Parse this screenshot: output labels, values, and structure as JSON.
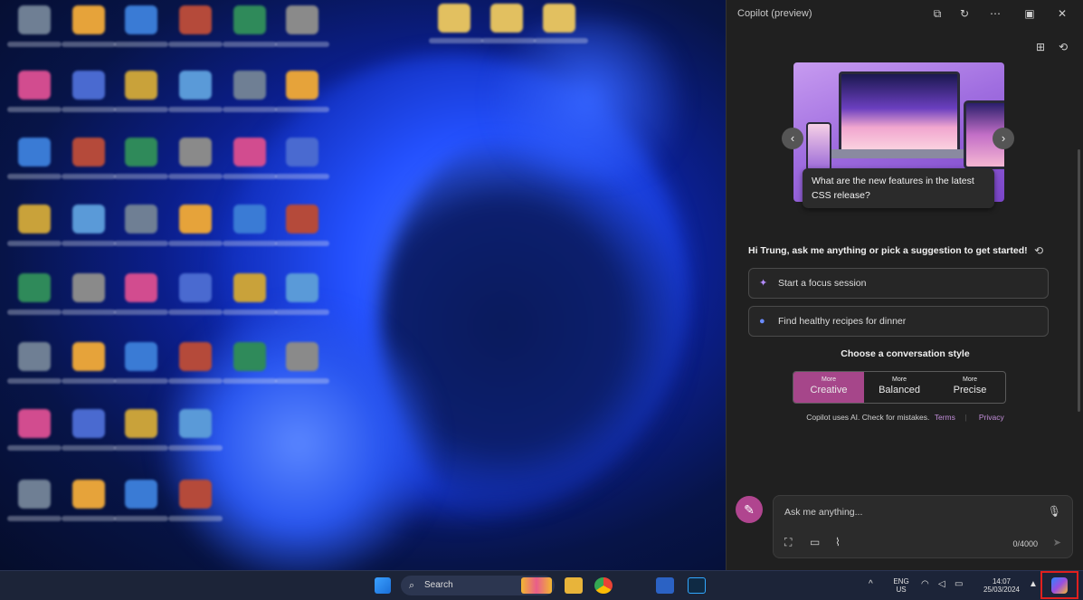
{
  "panel": {
    "title": "Copilot (preview)",
    "hero_caption": "What are the new features in the latest CSS release?",
    "greeting": "Hi Trung, ask me anything or pick a suggestion to get started!",
    "suggestions": [
      {
        "label": "Start a focus session",
        "icon": "sparkle-icon"
      },
      {
        "label": "Find healthy recipes for dinner",
        "icon": "globe-icon"
      }
    ],
    "style_title": "Choose a conversation style",
    "styles": [
      {
        "top": "More",
        "label": "Creative",
        "active": true
      },
      {
        "top": "More",
        "label": "Balanced",
        "active": false
      },
      {
        "top": "More",
        "label": "Precise",
        "active": false
      }
    ],
    "disclaimer": "Copilot uses AI. Check for mistakes.",
    "terms": "Terms",
    "privacy": "Privacy",
    "input_placeholder": "Ask me anything...",
    "char_count": "0/4000",
    "accent_color": "#a6468a"
  },
  "taskbar": {
    "search_label": "Search",
    "lang_line1": "ENG",
    "lang_line2": "US",
    "time": "14:07",
    "date": "25/03/2024"
  }
}
